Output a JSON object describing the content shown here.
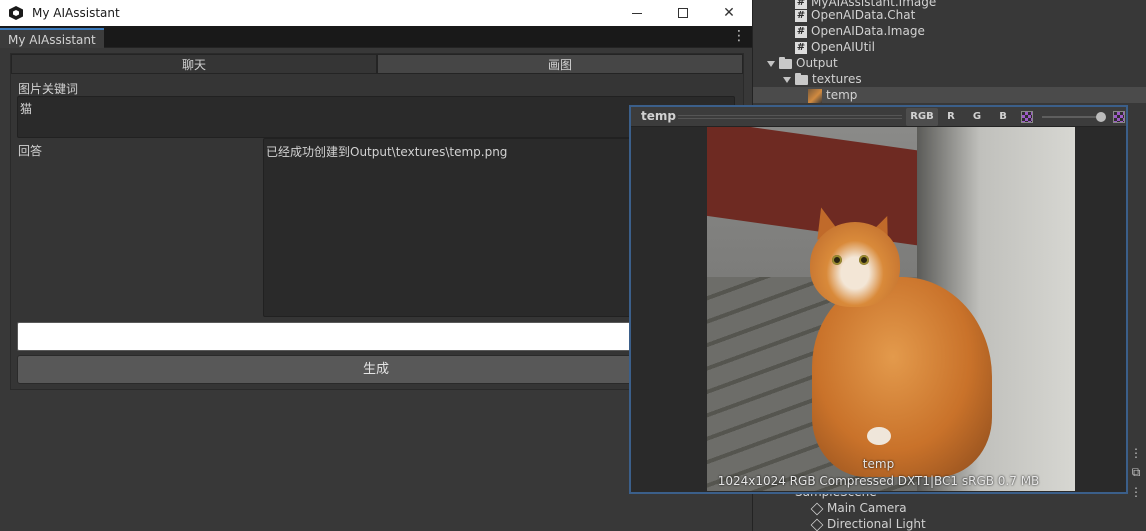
{
  "project": {
    "items": [
      {
        "label": "MyAIAssistant.Image",
        "icon": "script-icon",
        "indent": 3
      },
      {
        "label": "OpenAIData.Chat",
        "icon": "script-icon",
        "indent": 3
      },
      {
        "label": "OpenAIData.Image",
        "icon": "script-icon",
        "indent": 3
      },
      {
        "label": "OpenAIUtil",
        "icon": "script-icon",
        "indent": 3
      },
      {
        "label": "Output",
        "icon": "folder-icon",
        "indent": 1
      },
      {
        "label": "textures",
        "icon": "folder-icon",
        "indent": 2
      },
      {
        "label": "temp",
        "icon": "texture-icon",
        "indent": 3
      }
    ],
    "hierarchy": [
      {
        "label": "SampleScene"
      },
      {
        "label": "Main Camera"
      },
      {
        "label": "Directional Light"
      }
    ]
  },
  "window": {
    "title": "My AIAssistant",
    "tab": "My AIAssistant",
    "minimize": "—",
    "maximize": "☐",
    "close": "✕"
  },
  "toolbar": {
    "chat_label": "聊天",
    "image_label": "画图"
  },
  "form": {
    "keyword_label": "图片关键词",
    "keyword_value": "猫",
    "answer_label": "回答",
    "answer_value": "已经成功创建到Output\\textures\\temp.png",
    "input_value": "",
    "generate_label": "生成"
  },
  "preview": {
    "name": "temp",
    "channels": [
      "RGB",
      "R",
      "G",
      "B"
    ],
    "caption_name": "temp",
    "caption_info": "1024x1024  RGB Compressed DXT1|BC1 sRGB   0.7 MB",
    "mip_level": 1.0
  },
  "colors": {
    "accent": "#3a79bb",
    "editor_bg": "#383838"
  }
}
